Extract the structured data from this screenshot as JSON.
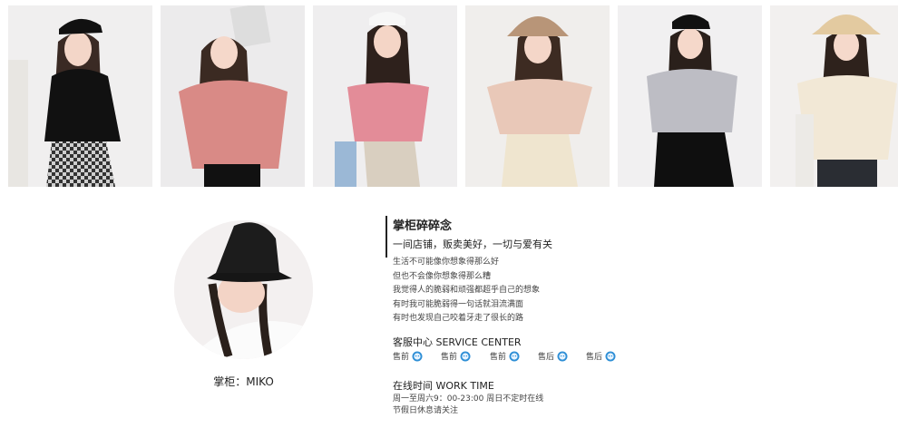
{
  "shop": {
    "owner_name": "掌柜：MIKO",
    "title": "掌柜碎碎念",
    "subtitle": "一间店铺，贩卖美好，一切与爱有关",
    "lines": [
      "生活不可能像你想象得那么好",
      "但也不会像你想象得那么糟",
      "我觉得人的脆弱和顽强都超乎自己的想象",
      "有时我可能脆弱得一句话就泪流满面",
      "有时也发现自己咬着牙走了很长的路"
    ]
  },
  "service": {
    "title": "客服中心 SERVICE CENTER",
    "items": [
      {
        "label": "售前",
        "icon": "chat-icon"
      },
      {
        "label": "售前",
        "icon": "chat-icon"
      },
      {
        "label": "售前",
        "icon": "chat-icon"
      },
      {
        "label": "售后",
        "icon": "chat-icon"
      },
      {
        "label": "售后",
        "icon": "chat-icon"
      }
    ]
  },
  "work": {
    "title": "在线时间 WORK TIME",
    "lines": [
      "周一至周六9：00-23:00 周日不定时在线",
      "节假日休息请关注"
    ]
  },
  "colors": {
    "chat_icon": "#2f8fd6",
    "divider": "#222222"
  },
  "photos": [
    {
      "name": "model-photo-black-tee",
      "hat": "black cap",
      "top": "black tee",
      "bottom": "checked pants"
    },
    {
      "name": "model-photo-pink-tee",
      "hat": "none",
      "top": "pink tee",
      "bottom": "black skirt"
    },
    {
      "name": "model-photo-pink-gingham",
      "hat": "white cap",
      "top": "pink gingham top",
      "bottom": "beige pants"
    },
    {
      "name": "model-photo-beige-blouse",
      "hat": "bucket hat",
      "top": "beige blouse",
      "bottom": "cream skirt"
    },
    {
      "name": "model-photo-grey-top",
      "hat": "black cap",
      "top": "grey top",
      "bottom": "black skirt"
    },
    {
      "name": "model-photo-cream-blouse",
      "hat": "straw hat",
      "top": "cream blouse",
      "bottom": "dark jeans"
    }
  ]
}
